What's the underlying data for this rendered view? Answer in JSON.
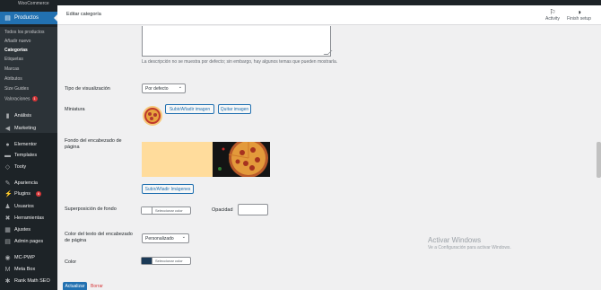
{
  "sidebar": {
    "woo_label": "WooCommerce",
    "active": "Productos",
    "sub_items": [
      "Todos los productos",
      "Añadir nuevo",
      "Categorías",
      "Etiquetas",
      "Marcas",
      "Atributos",
      "Size Guides",
      "Valoraciones"
    ],
    "reviews_badge": "1",
    "items": [
      {
        "label": "Análisis",
        "icon": "chart-bar-icon"
      },
      {
        "label": "Marketing",
        "icon": "megaphone-icon"
      },
      {
        "label": "Elementor",
        "icon": "elementor-icon"
      },
      {
        "label": "Templates",
        "icon": "folder-icon"
      },
      {
        "label": "Tooty",
        "icon": "tooty-icon"
      },
      {
        "label": "Apariencia",
        "icon": "brush-icon"
      },
      {
        "label": "Plugins",
        "icon": "plugin-icon"
      },
      {
        "label": "Usuarios",
        "icon": "users-icon"
      },
      {
        "label": "Herramientas",
        "icon": "wrench-icon"
      },
      {
        "label": "Ajustes",
        "icon": "settings-icon"
      },
      {
        "label": "Admin pages",
        "icon": "admin-pages-icon"
      },
      {
        "label": "MC-PWP",
        "icon": "circle-icon"
      },
      {
        "label": "Meta Box",
        "icon": "metabox-icon"
      },
      {
        "label": "Rank Math SEO",
        "icon": "rankmath-icon"
      }
    ],
    "plugins_badge": "6"
  },
  "header": {
    "title": "Editar categoría",
    "activity": "Activity",
    "finish_setup": "Finish setup"
  },
  "form": {
    "description_help": "La descripción no se muestra por defecto; sin embargo, hay algunos temas que pueden mostrarla.",
    "display_type_label": "Tipo de visualización",
    "display_type_value": "Por defecto",
    "thumbnail_label": "Miniatura",
    "upload_image_button": "Subir/Añadir imagen",
    "remove_image_button": "Quitar imagen",
    "header_bg_label": "Fondo del encabezado de página",
    "upload_images_button": "Subir/Añadir Imágenes",
    "overlay_label": "Superposición de fondo",
    "select_color": "Seleccionar color",
    "opacity_label": "Opacidad",
    "header_text_color_label": "Color del texto del encabezado de página",
    "header_text_color_value": "Personalizado",
    "color_label": "Color",
    "color_select": "Seleccionar color",
    "update_button": "Actualizar",
    "delete_link": "Borrar"
  },
  "watermark": {
    "title": "Activar Windows",
    "subtitle": "Ve a Configuración para activar Windows."
  },
  "colors": {
    "sidebar_bg": "#1d2327",
    "accent": "#2271b1",
    "color_swatch": "#1b3a57",
    "header_bg_fill": "#ffdc9c"
  }
}
